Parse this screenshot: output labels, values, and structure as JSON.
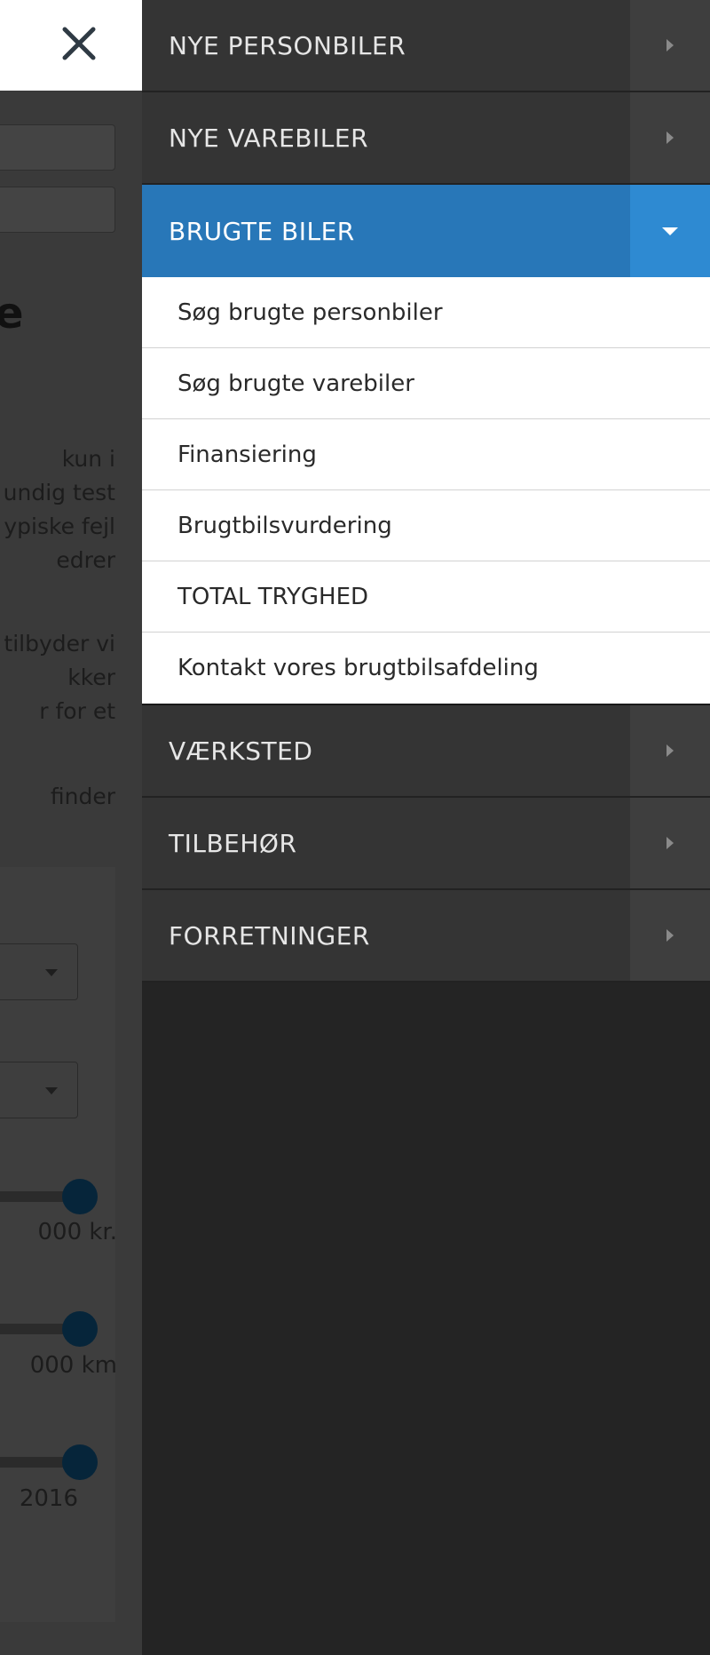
{
  "background_page": {
    "heading_fragment": "e",
    "paragraph1_lines": [
      "kun i",
      "undig test",
      "ypiske fejl",
      "edrer"
    ],
    "paragraph2_lines": [
      "tilbyder vi",
      "kker",
      "r for et"
    ],
    "paragraph3_lines": [
      "finder"
    ],
    "price_value": "000 kr.",
    "km_value": "000 km",
    "year_value": "2016"
  },
  "nav": {
    "items": [
      {
        "label": "NYE PERSONBILER"
      },
      {
        "label": "NYE VAREBILER"
      },
      {
        "label": "BRUGTE BILER",
        "active": true,
        "subitems": [
          {
            "label": "Søg brugte personbiler"
          },
          {
            "label": "Søg brugte varebiler"
          },
          {
            "label": "Finansiering"
          },
          {
            "label": "Brugtbilsvurdering"
          },
          {
            "label": "TOTAL TRYGHED"
          },
          {
            "label": "Kontakt vores brugtbilsafdeling"
          }
        ]
      },
      {
        "label": "VÆRKSTED"
      },
      {
        "label": "TILBEHØR"
      },
      {
        "label": "FORRETNINGER"
      }
    ]
  },
  "colors": {
    "active_bg": "#2877b8",
    "active_toggle_bg": "#2e8ad2",
    "drawer_bg": "#242424",
    "nav_item_bg": "#343434"
  }
}
